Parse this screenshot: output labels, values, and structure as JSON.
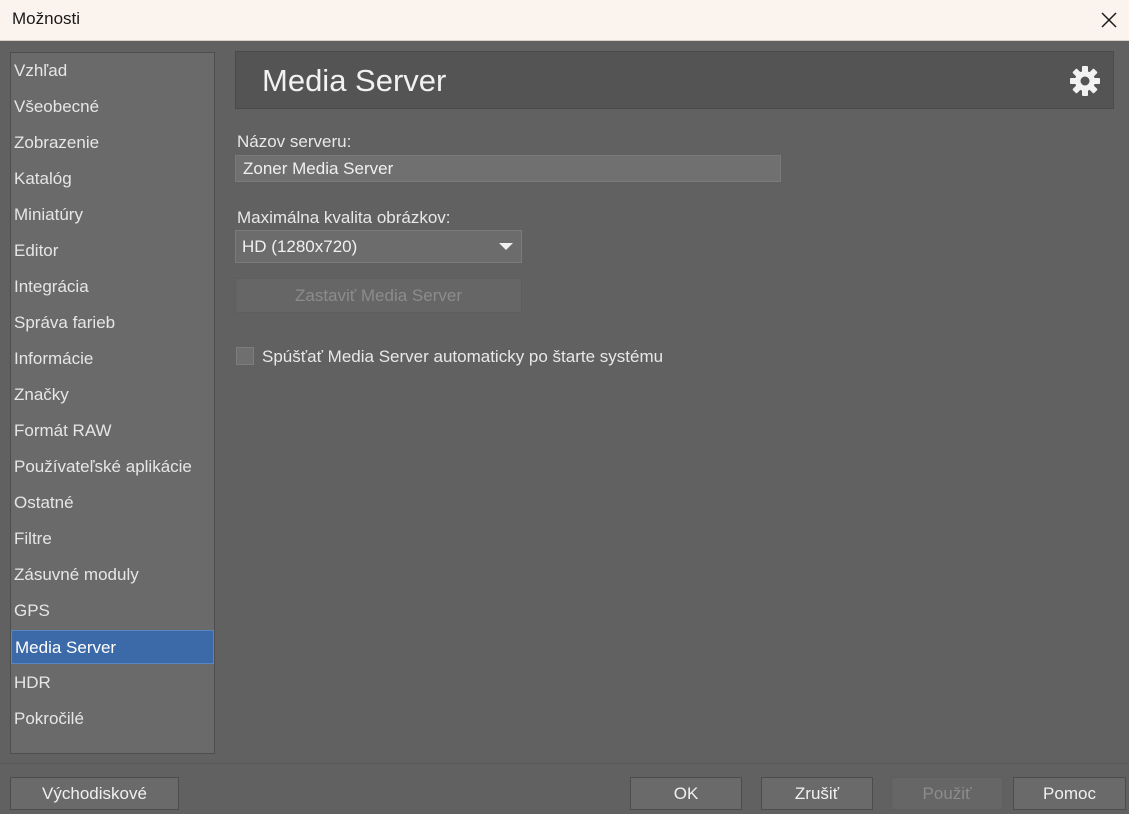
{
  "window": {
    "title": "Možnosti",
    "close_icon": "close-icon"
  },
  "sidebar": {
    "items": [
      {
        "label": "Vzhľad"
      },
      {
        "label": "Všeobecné"
      },
      {
        "label": "Zobrazenie"
      },
      {
        "label": "Katalóg"
      },
      {
        "label": "Miniatúry"
      },
      {
        "label": "Editor"
      },
      {
        "label": "Integrácia"
      },
      {
        "label": "Správa farieb"
      },
      {
        "label": "Informácie"
      },
      {
        "label": "Značky"
      },
      {
        "label": "Formát RAW"
      },
      {
        "label": "Používateľské aplikácie"
      },
      {
        "label": "Ostatné"
      },
      {
        "label": "Filtre"
      },
      {
        "label": "Zásuvné moduly"
      },
      {
        "label": "GPS"
      },
      {
        "label": "Media Server",
        "selected": true
      },
      {
        "label": "HDR"
      },
      {
        "label": "Pokročilé"
      }
    ],
    "selected_color": "#3c6aa8"
  },
  "header": {
    "title": "Media Server",
    "icon": "gear-icon"
  },
  "form": {
    "server_name_label": "Názov serveru:",
    "server_name_value": "Zoner Media Server",
    "quality_label": "Maximálna kvalita obrázkov:",
    "quality_selected": "HD (1280x720)",
    "stop_button_label": "Zastaviť Media Server",
    "autostart_label": "Spúšťať Media Server automaticky po štarte systému",
    "autostart_checked": false
  },
  "footer": {
    "defaults_label": "Východiskové",
    "ok_label": "OK",
    "cancel_label": "Zrušiť",
    "apply_label": "Použiť",
    "help_label": "Pomoc"
  }
}
